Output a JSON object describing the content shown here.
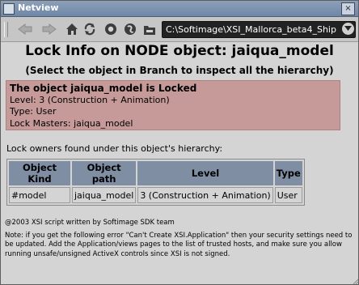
{
  "window": {
    "title": "Netview",
    "close_label": "×"
  },
  "toolbar": {
    "buttons": [
      {
        "name": "back",
        "icon": "arrow-left-icon"
      },
      {
        "name": "forward",
        "icon": "arrow-right-icon"
      },
      {
        "name": "home",
        "icon": "home-icon"
      },
      {
        "name": "refresh",
        "icon": "refresh-icon"
      },
      {
        "name": "stop",
        "icon": "stop-icon"
      },
      {
        "name": "sync",
        "icon": "sync-icon"
      },
      {
        "name": "folder",
        "icon": "folder-icon"
      }
    ],
    "address": "C:\\Softimage\\XSI_Mallorca_beta4_Ship"
  },
  "page": {
    "heading": "Lock Info on NODE object: jaiqua_model",
    "subheading": "(Select the object in Branch to inspect all the hierarchy)",
    "lock": {
      "status": "The object jaiqua_model is Locked",
      "level": "Level: 3 (Construction + Animation)",
      "type": "Type: User",
      "masters": "Lock Masters: jaiqua_model"
    },
    "owners_label": "Lock owners found under this object's hierarchy:",
    "table": {
      "headers": [
        "Object Kind",
        "Object path",
        "Level",
        "Type"
      ],
      "rows": [
        [
          "#model",
          "jaiqua_model",
          "3 (Construction + Animation)",
          "User"
        ]
      ]
    },
    "copyright": "@2003 XSI script written by Softimage SDK team",
    "note": "Note: if you get the following error \"Can't Create XSI.Application\" then your security settings need to be updated. Add the Application/views pages to the list of trusted hosts, and make sure you allow running unsafe/unsigned ActiveX controls since XSI is not signed."
  },
  "colors": {
    "lock_box": "#c79a9a",
    "table_header": "#7f8ea3",
    "titlebar": "#7a8fae"
  }
}
